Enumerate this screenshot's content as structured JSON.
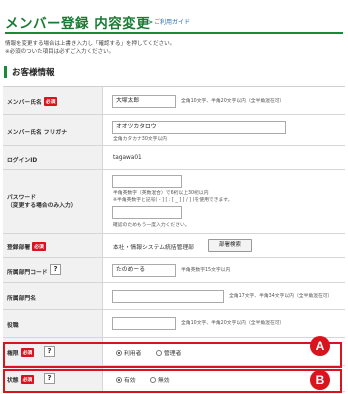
{
  "header": {
    "title": "メンバー登録 内容変更",
    "guide_link": "ご利用ガイド"
  },
  "intro": {
    "line1": "情報を変更する場合は上書き入力し「確認する」を押してください。",
    "line2": "※必須のついた項目は必ずご入力ください。"
  },
  "section": {
    "title": "お客様情報"
  },
  "required_label": "必須",
  "help_label": "?",
  "fields": {
    "name": {
      "label": "メンバー氏名",
      "value": "大塚太郎",
      "note": "全角10文字、半角20文字以内（全半角混在可）"
    },
    "kana": {
      "label": "メンバー氏名 フリガナ",
      "value": "オオツカタロウ",
      "note": "全角カタカナ30文字以内"
    },
    "login": {
      "label": "ログインID",
      "value": "tagawa01"
    },
    "password": {
      "label1": "パスワード",
      "label2": "（変更する場合のみ入力）",
      "note1": "半角英数字（英数混合）で6桁以上30桁以内",
      "note2": "※半角英数字と記号( - ] [ : [ _ ] [ / ] )を使用できます。",
      "confirm_note": "確認のためもう一度入力ください。"
    },
    "department": {
      "label": "登録部署",
      "value": "本社・情報システム統括管理部",
      "button": "部署検索"
    },
    "dept_code": {
      "label": "所属部門コード",
      "value": "たのめーる",
      "note": "半角英数字15文字以内"
    },
    "dept_name": {
      "label": "所属部門名",
      "value": "",
      "note": "全角17文字、半角34文字以内（全半角混在可）"
    },
    "position": {
      "label": "役職",
      "value": "",
      "note": "全角10文字、半角20文字以内（全半角混在可）"
    },
    "authority": {
      "label": "権限",
      "options": [
        "利用者",
        "管理者"
      ],
      "selected": "利用者"
    },
    "status": {
      "label": "状態",
      "options": [
        "有効",
        "無効"
      ],
      "selected": "有効"
    }
  },
  "callouts": {
    "a": "A",
    "b": "B"
  },
  "colors": {
    "brand_green": "#1a7a32",
    "required_red": "#d9141e",
    "label_bg": "#f1f1f1"
  }
}
